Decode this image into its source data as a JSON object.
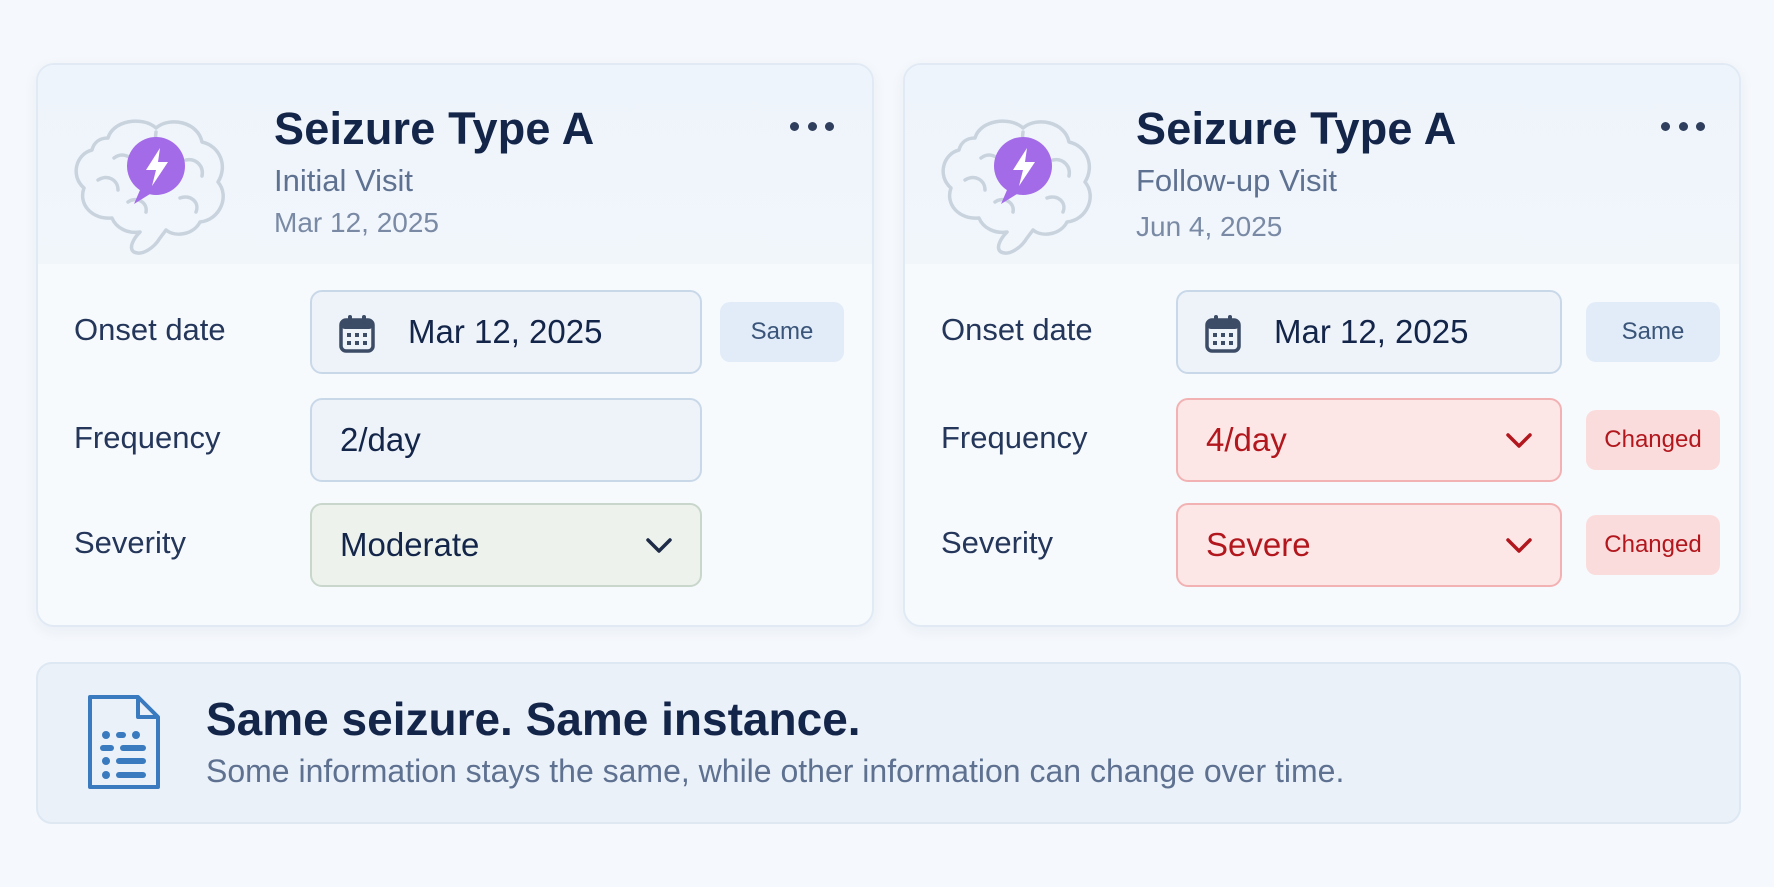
{
  "cards": [
    {
      "title": "Seizure Type A",
      "visit": "Initial Visit",
      "date": "Mar 12, 2025",
      "fields": {
        "onset": {
          "label": "Onset date",
          "value": "Mar 12, 2025",
          "badge": "Same"
        },
        "frequency": {
          "label": "Frequency",
          "value": "2/day"
        },
        "severity": {
          "label": "Severity",
          "value": "Moderate"
        }
      }
    },
    {
      "title": "Seizure Type A",
      "visit": "Follow-up Visit",
      "date": "Jun 4, 2025",
      "fields": {
        "onset": {
          "label": "Onset date",
          "value": "Mar 12, 2025",
          "badge": "Same"
        },
        "frequency": {
          "label": "Frequency",
          "value": "4/day",
          "badge": "Changed"
        },
        "severity": {
          "label": "Severity",
          "value": "Severe",
          "badge": "Changed"
        }
      }
    }
  ],
  "banner": {
    "title": "Same seizure. Same instance.",
    "text": "Some information stays the same, while other information can change over time."
  },
  "icons": {
    "card": "brain-with-lightning-icon",
    "menu": "more-horizontal-icon",
    "date": "calendar-icon",
    "dropdown": "chevron-down-icon",
    "banner": "document-list-icon"
  },
  "colors": {
    "title": "#14254a",
    "accent_purple": "#a46be8",
    "changed_red": "#b1171d",
    "changed_bg": "#fde6e6",
    "same_bg": "#e1ecf8",
    "moderate_bg": "#edf3ec"
  }
}
